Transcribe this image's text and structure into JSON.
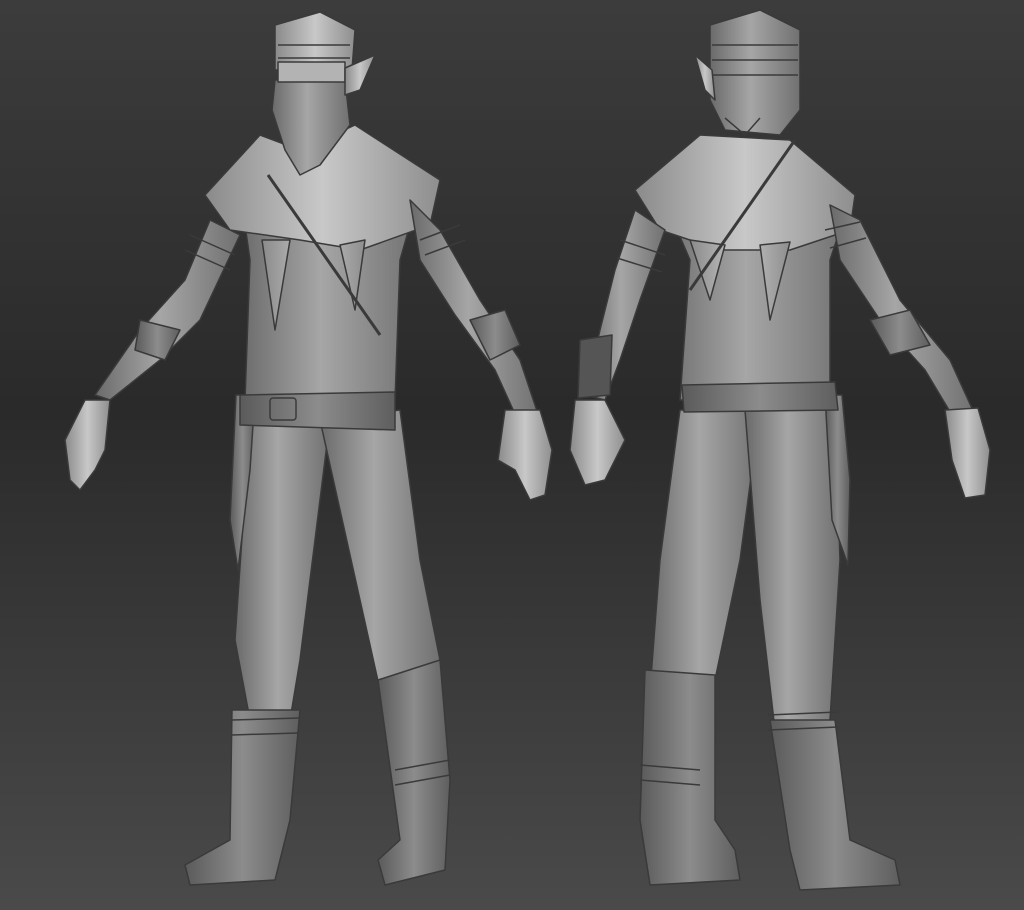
{
  "scene": {
    "background_top": "#3c3c3c",
    "background_bottom": "#4a4a4a",
    "clay_color": "#8d8d8d",
    "clay_highlight": "#c4c4c4",
    "clay_shadow": "#5c5c5c"
  },
  "figures": [
    {
      "view": "front",
      "subject": "elf-ninja-sculpt"
    },
    {
      "view": "back",
      "subject": "elf-ninja-sculpt"
    }
  ]
}
